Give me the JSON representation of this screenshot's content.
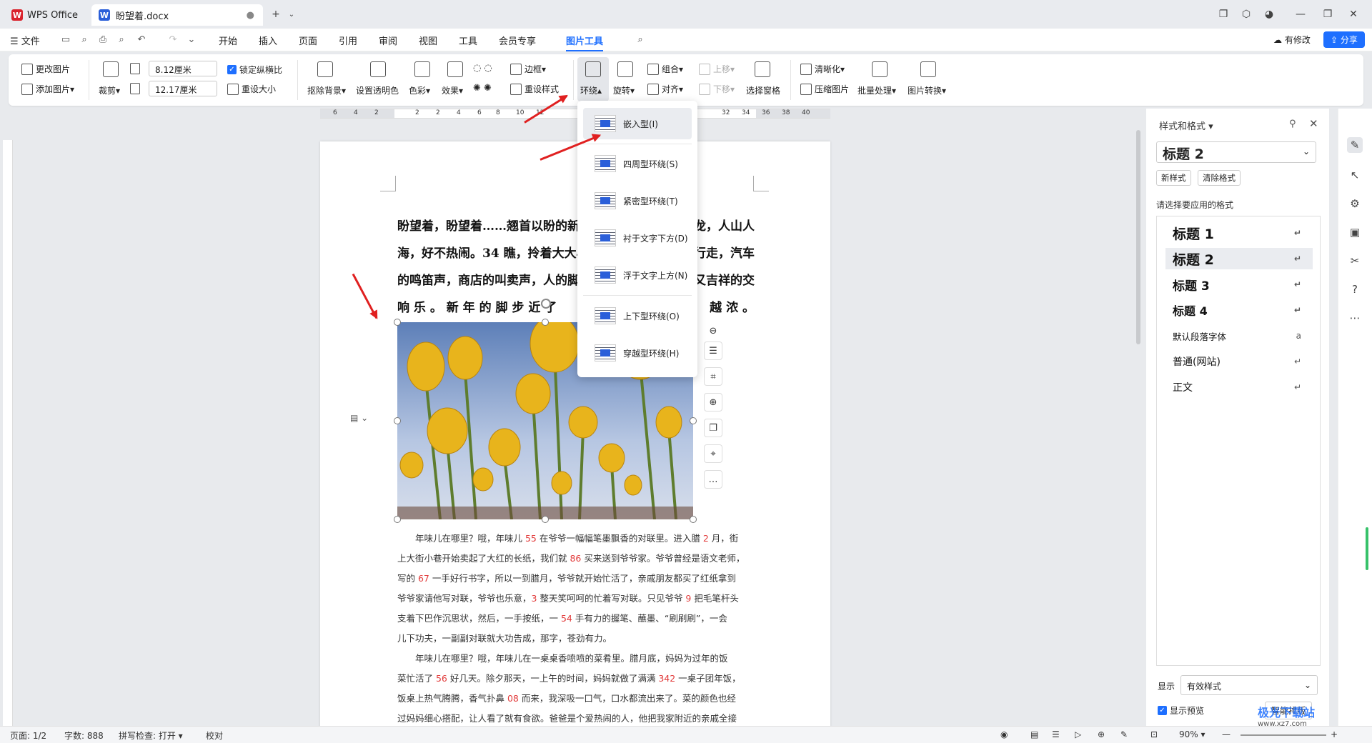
{
  "tabs": {
    "app": "WPS Office",
    "doc": "盼望着.docx"
  },
  "menu": {
    "file": "文件",
    "items": [
      "开始",
      "插入",
      "页面",
      "引用",
      "审阅",
      "视图",
      "工具",
      "会员专享",
      "图片工具"
    ],
    "modified": "有修改",
    "share": "分享"
  },
  "ribbon": {
    "change_image": "更改图片",
    "add_image": "添加图片",
    "crop": "裁剪",
    "width": "8.12厘米",
    "height": "12.17厘米",
    "lock_ratio": "锁定纵横比",
    "reset_size": "重设大小",
    "remove_bg": "抠除背景",
    "set_transparent": "设置透明色",
    "color": "色彩",
    "effect": "效果",
    "border": "边框",
    "reset_style": "重设样式",
    "wrap": "环绕",
    "rotate": "旋转",
    "group": "组合",
    "align": "对齐",
    "up": "上移",
    "down": "下移",
    "selection_pane": "选择窗格",
    "sharpen": "清晰化",
    "compress": "压缩图片",
    "batch": "批量处理",
    "convert": "图片转换"
  },
  "ruler": {
    "numbers": [
      "6",
      "4",
      "2",
      "2",
      "2",
      "4",
      "6",
      "8",
      "10",
      "12",
      "32",
      "34",
      "36",
      "38",
      "40"
    ]
  },
  "wrap_menu": {
    "items": [
      "嵌入型(I)",
      "四周型环绕(S)",
      "紧密型环绕(T)",
      "衬于文字下方(D)",
      "浮于文字上方(N)",
      "上下型环绕(O)",
      "穿越型环绕(H)"
    ]
  },
  "document": {
    "heading_lines": [
      "盼望着，盼望着……翘首以盼的新",
      "龙，人山人",
      "海，好不热闹。34 瞧，拎着大大小",
      "行走，汽车",
      "的鸣笛声，商店的叫卖声，人的脚",
      "又吉祥的交",
      "响 乐 。 新 年 的 脚 步 近 了",
      "越 浓 。"
    ],
    "para1": [
      [
        "年味儿在哪里？哦，年味儿 ",
        "55",
        " 在爷爷一幅幅笔墨飘香的对联里。进入腊 ",
        "2",
        " 月，街"
      ],
      [
        "上大街小巷开始卖起了大红的长纸，我们就 ",
        "86",
        " 买来送到爷爷家。爷爷曾经是语文老师，"
      ],
      [
        "写的 ",
        "67",
        " 一手好行书字，所以一到腊月，爷爷就开始忙活了，亲戚朋友都买了红纸拿到"
      ],
      [
        "爷爷家请他写对联，爷爷也乐意，",
        "3",
        " 整天笑呵呵的忙着写对联。只见爷爷 ",
        "9",
        " 把毛笔杆头"
      ],
      [
        "支着下巴作沉思状，然后，一手按纸，一 ",
        "54",
        " 手有力的握笔、蘸墨、“刷刷刷”，一会"
      ],
      [
        "儿下功夫，一副副对联就大功告成，那字，苍劲有力。",
        ""
      ]
    ],
    "para2": [
      [
        "年味儿在哪里？哦，年味儿在一桌桌香喷喷的菜肴里。腊月底，妈妈为过年的饭",
        ""
      ],
      [
        "菜忙活了 ",
        "56",
        " 好几天。除夕那天，一上午的时间，妈妈就做了满满 ",
        "342",
        " 一桌子团年饭，"
      ],
      [
        "饭桌上热气腾腾，香气扑鼻 ",
        "08",
        " 而来，我深吸一口气，口水都流出来了。菜的颜色也经"
      ],
      [
        "过妈妈细心搭配，让人看了就有食欲。爸爸是个爱热闹的人，他把我家附近的亲戚全接",
        ""
      ]
    ]
  },
  "style_panel": {
    "title": "样式和格式",
    "current": "标题 2",
    "new_style": "新样式",
    "clear_format": "清除格式",
    "prompt": "请选择要应用的格式",
    "styles": [
      "标题 1",
      "标题 2",
      "标题 3",
      "标题 4",
      "默认段落字体",
      "普通(网站)",
      "正文"
    ],
    "show_label": "显示",
    "show_value": "有效样式",
    "preview": "显示预览",
    "smart": "智能排版"
  },
  "status": {
    "page": "页面: 1/2",
    "words": "字数: 888",
    "spell": "拼写检查: 打开",
    "proof": "校对",
    "zoom": "90%"
  },
  "watermark": "极光下载站",
  "watermark_url": "www.xz7.com"
}
